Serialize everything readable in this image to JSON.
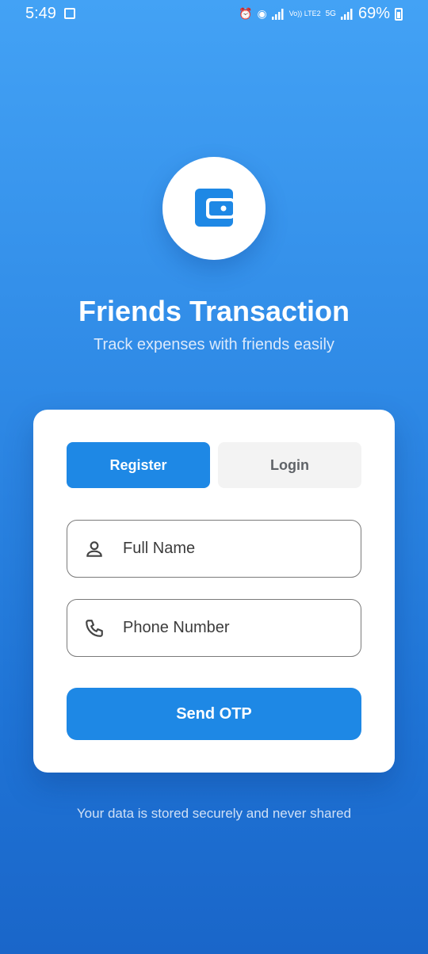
{
  "status_bar": {
    "time": "5:49",
    "battery": "69%",
    "network_lte": "Vo)) LTE2",
    "network_5g": "5G"
  },
  "app": {
    "title": "Friends Transaction",
    "subtitle": "Track expenses with friends easily"
  },
  "tabs": {
    "register": "Register",
    "login": "Login",
    "active": "register"
  },
  "form": {
    "full_name_placeholder": "Full Name",
    "phone_placeholder": "Phone Number",
    "submit_label": "Send OTP"
  },
  "footer": {
    "note": "Your data is stored securely and never shared"
  },
  "icons": {
    "logo": "wallet-icon",
    "name_field": "person-icon",
    "phone_field": "phone-icon"
  },
  "colors": {
    "primary": "#1e88e5",
    "background_top": "#43a2f5",
    "background_bottom": "#1a66c9",
    "card": "#ffffff",
    "inactive_tab": "#f3f3f3"
  }
}
